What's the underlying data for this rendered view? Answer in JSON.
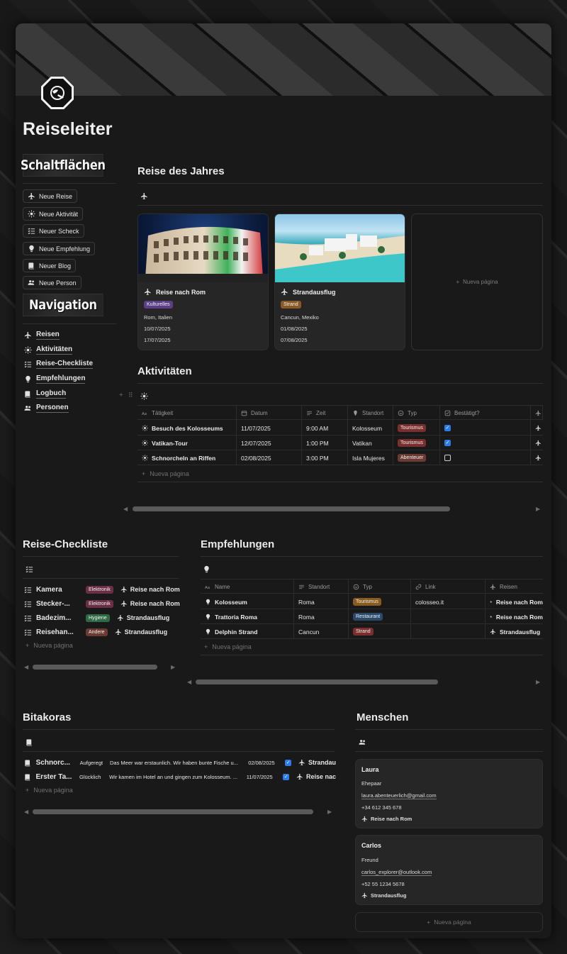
{
  "page": {
    "title": "Reiseleiter"
  },
  "left": {
    "heading_buttons": "Schaltflächen",
    "buttons": [
      {
        "label": "Neue Reise",
        "icon": "airplane-icon"
      },
      {
        "label": "Neue Aktivität",
        "icon": "sun-icon"
      },
      {
        "label": "Neuer Scheck",
        "icon": "checklist-icon"
      },
      {
        "label": "Neue Empfehlung",
        "icon": "lightbulb-icon"
      },
      {
        "label": "Neuer Blog",
        "icon": "book-icon"
      },
      {
        "label": "Neue Person",
        "icon": "people-icon"
      }
    ],
    "heading_navigation": "Navigation",
    "nav": [
      {
        "label": "Reisen",
        "icon": "airplane-icon"
      },
      {
        "label": "Aktivitäten",
        "icon": "sun-icon"
      },
      {
        "label": "Reise-Checkliste",
        "icon": "checklist-icon"
      },
      {
        "label": "Empfehlungen",
        "icon": "lightbulb-icon"
      },
      {
        "label": "Logbuch",
        "icon": "book-icon"
      },
      {
        "label": "Personen",
        "icon": "people-icon"
      }
    ]
  },
  "trips": {
    "title": "Reise des Jahres",
    "cards": [
      {
        "name": "Reise nach Rom",
        "tag": "Kulturelles",
        "tag_color": "#5b3f86",
        "place": "Rom, Italien",
        "start": "10/07/2025",
        "end": "17/07/2025"
      },
      {
        "name": "Strandausflug",
        "tag": "Strand",
        "tag_color": "#8a5a26",
        "place": "Cancun, Mexiko",
        "start": "01/08/2025",
        "end": "07/08/2025"
      }
    ],
    "new_page": "Nueva página"
  },
  "activities": {
    "title": "Aktivitäten",
    "headers": [
      "Tätigkeit",
      "Datum",
      "Zeit",
      "Standort",
      "Typ",
      "Bestätigt?"
    ],
    "rows": [
      {
        "name": "Besuch des Kolosseums",
        "date": "11/07/2025",
        "time": "9:00 AM",
        "place": "Kolosseum",
        "type": "Tourismus",
        "type_color": "#7a2e2e",
        "confirmed": true
      },
      {
        "name": "Vatikan-Tour",
        "date": "12/07/2025",
        "time": "1:00 PM",
        "place": "Vatikan",
        "type": "Tourismus",
        "type_color": "#7a2e2e",
        "confirmed": true
      },
      {
        "name": "Schnorcheln an Riffen",
        "date": "02/08/2025",
        "time": "3:00 PM",
        "place": "Isla Mujeres",
        "type": "Abenteuer",
        "type_color": "#6b3b32",
        "confirmed": false
      }
    ],
    "new_page": "Nueva página"
  },
  "checklist": {
    "title": "Reise-Checkliste",
    "rows": [
      {
        "name": "Kamera",
        "tag": "Elektronik",
        "tag_color": "#6b2e45",
        "trip": "Reise nach Rom"
      },
      {
        "name": "Stecker-...",
        "tag": "Elektronik",
        "tag_color": "#6b2e45",
        "trip": "Reise nach Rom"
      },
      {
        "name": "Badezim...",
        "tag": "Hygiene",
        "tag_color": "#2e6b44",
        "trip": "Strandausflug"
      },
      {
        "name": "Reisehan...",
        "tag": "Andere",
        "tag_color": "#6b3b32",
        "trip": "Strandausflug"
      }
    ],
    "new_page": "Nueva página"
  },
  "recommendations": {
    "title": "Empfehlungen",
    "headers": [
      "Name",
      "Standort",
      "Typ",
      "Link",
      "Reisen"
    ],
    "rows": [
      {
        "name": "Kolosseum",
        "place": "Roma",
        "type": "Tourismus",
        "type_color": "#8a5a1e",
        "link": "colosseo.it",
        "trip": "Reise nach Rom"
      },
      {
        "name": "Trattoria Roma",
        "place": "Roma",
        "type": "Restaurant",
        "type_color": "#2a4a6b",
        "link": "",
        "trip": "Reise nach Rom"
      },
      {
        "name": "Delphin Strand",
        "place": "Cancun",
        "type": "Strand",
        "type_color": "#7a2e2e",
        "link": "",
        "trip": "Strandausflug"
      }
    ],
    "new_page": "Nueva página"
  },
  "logbook": {
    "title": "Bitakoras",
    "rows": [
      {
        "name": "Schnorc...",
        "mood": "Aufgeregt",
        "text": "Das Meer war erstaunlich. Wir haben bunte Fische u...",
        "date": "02/08/2025",
        "trip": "Strandau"
      },
      {
        "name": "Erster Ta...",
        "mood": "Glücklich",
        "text": "Wir kamen im Hotel an und gingen zum Kolosseum. ...",
        "date": "11/07/2025",
        "trip": "Reise nac"
      }
    ],
    "new_page": "Nueva página"
  },
  "people": {
    "title": "Menschen",
    "cards": [
      {
        "name": "Laura",
        "relation": "Ehepaar",
        "email": "laura.abenteuerlich@gmail.com",
        "phone": "+34 612 345 678",
        "trip": "Reise nach Rom"
      },
      {
        "name": "Carlos",
        "relation": "Freund",
        "email": "carlos_explorer@outlook.com",
        "phone": "+52 55 1234 5678",
        "trip": "Strandausflug"
      }
    ],
    "new_page": "Nueva página"
  }
}
